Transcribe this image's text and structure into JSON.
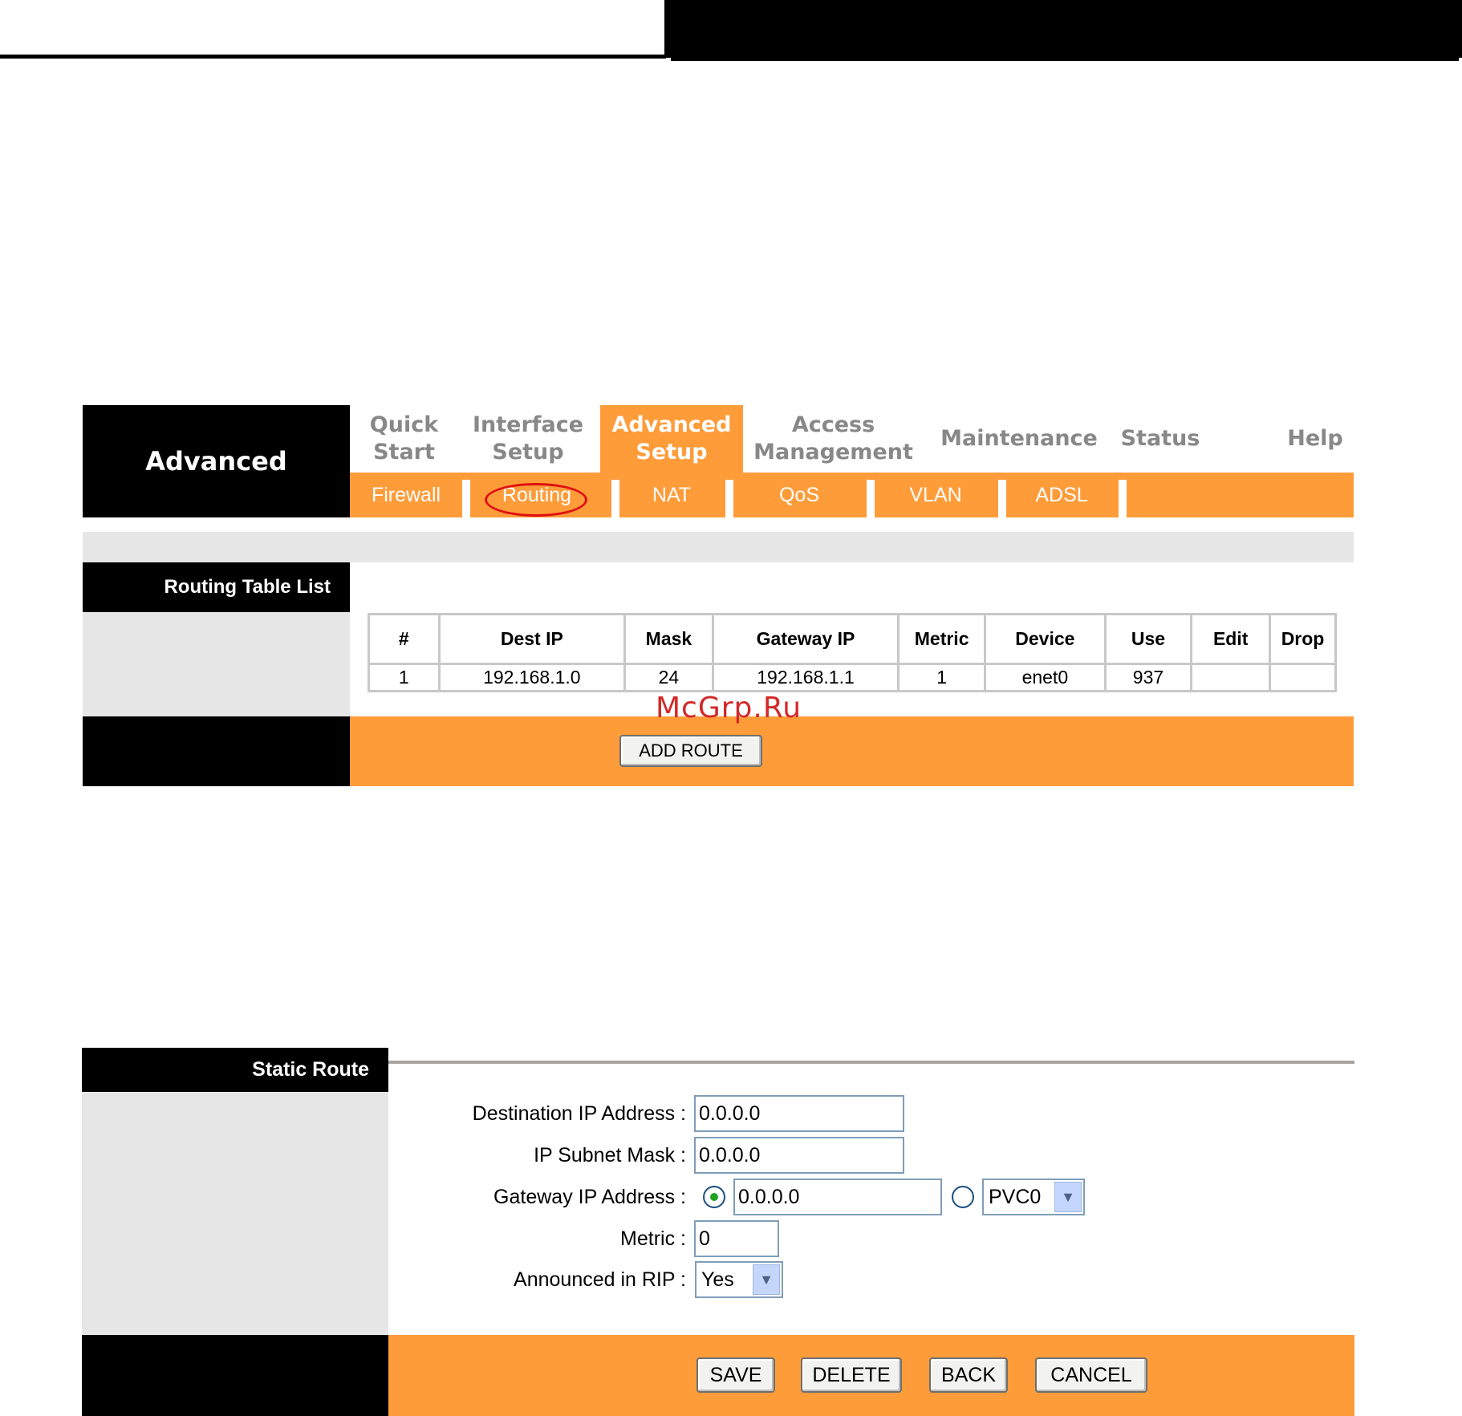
{
  "nav": {
    "brand": "Advanced",
    "items": [
      {
        "label": "Quick\nStart",
        "active": false
      },
      {
        "label": "Interface\nSetup",
        "active": false
      },
      {
        "label": "Advanced\nSetup",
        "active": true
      },
      {
        "label": "Access\nManagement",
        "active": false
      },
      {
        "label": "Maintenance",
        "active": false
      },
      {
        "label": "Status",
        "active": false
      },
      {
        "label": "Help",
        "active": false
      }
    ],
    "subnav": [
      "Firewall",
      "Routing",
      "NAT",
      "QoS",
      "VLAN",
      "ADSL"
    ],
    "highlighted_subnav": "Routing"
  },
  "routing_table": {
    "title": "Routing Table List",
    "columns": [
      "#",
      "Dest IP",
      "Mask",
      "Gateway IP",
      "Metric",
      "Device",
      "Use",
      "Edit",
      "Drop"
    ],
    "rows": [
      [
        "1",
        "192.168.1.0",
        "24",
        "192.168.1.1",
        "1",
        "enet0",
        "937",
        "",
        ""
      ]
    ],
    "add_button": "ADD ROUTE"
  },
  "watermark": "McGrp.Ru",
  "static_route": {
    "title": "Static Route",
    "fields": {
      "dest_ip_label": "Destination IP Address :",
      "dest_ip_value": "0.0.0.0",
      "subnet_label": "IP Subnet Mask :",
      "subnet_value": "0.0.0.0",
      "gateway_label": "Gateway IP Address :",
      "gateway_value": "0.0.0.0",
      "gateway_mode": "ip",
      "pvc_value": "PVC0",
      "metric_label": "Metric :",
      "metric_value": "0",
      "rip_label": "Announced in RIP :",
      "rip_value": "Yes"
    },
    "buttons": {
      "save": "SAVE",
      "delete": "DELETE",
      "back": "BACK",
      "cancel": "CANCEL"
    }
  },
  "colors": {
    "accent_orange": "#ff9c3a",
    "panel_gray": "#e6e6e6",
    "header_black": "#000000",
    "highlight_red": "#e01010",
    "watermark_red": "#d42828"
  }
}
